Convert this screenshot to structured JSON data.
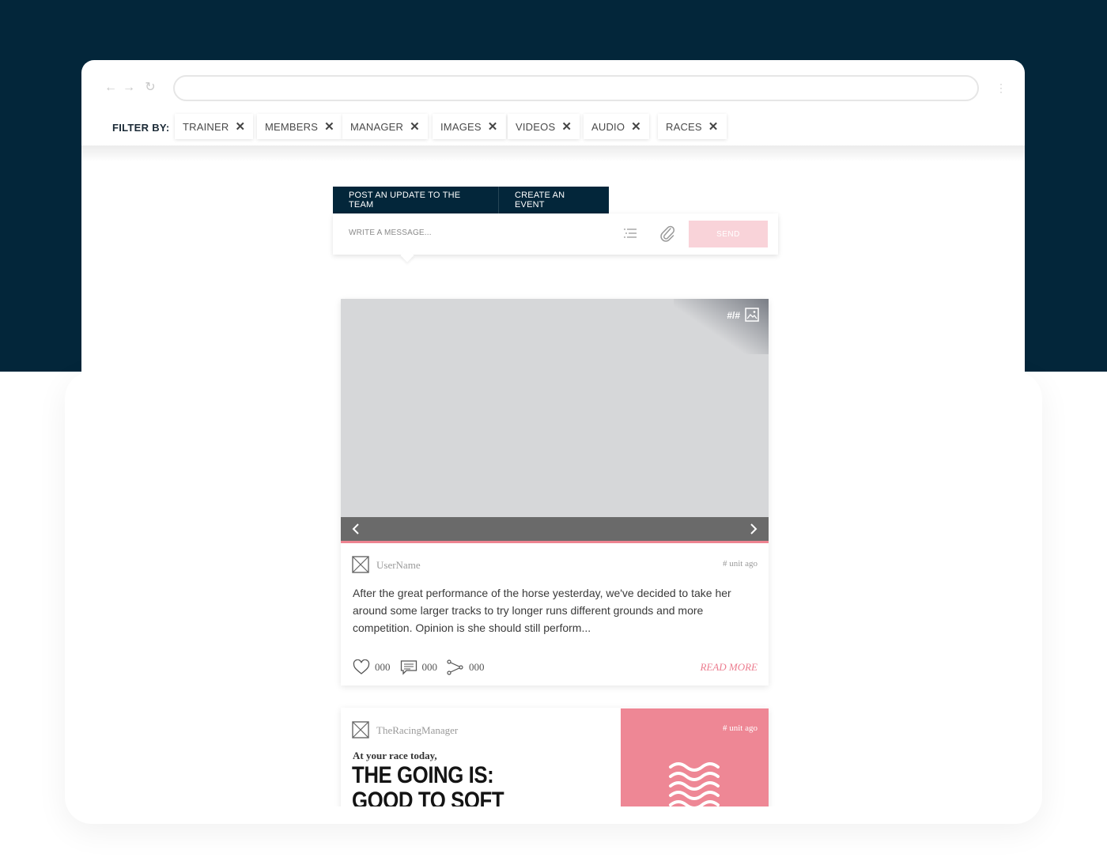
{
  "filter": {
    "label": "FILTER BY:",
    "chips": [
      "TRAINER",
      "MEMBERS",
      "MANAGER",
      "IMAGES",
      "VIDEOS",
      "AUDIO",
      "RACES"
    ],
    "remove_glyph": "✕"
  },
  "composer": {
    "tabs": [
      "POST AN UPDATE TO THE TEAM",
      "CREATE AN EVENT"
    ],
    "placeholder": "WRITE A MESSAGE...",
    "send_label": "SEND"
  },
  "post": {
    "media_count": "#/#",
    "username": "UserName",
    "time": "# unit ago",
    "body": "After the great performance of the horse yesterday, we've decided to take her around some larger tracks to try longer runs different grounds and more competition. Opinion is she should still perform...",
    "likes": "000",
    "comments": "000",
    "shares": "000",
    "read_more": "READ MORE"
  },
  "post2": {
    "username": "TheRacingManager",
    "time": "# unit ago",
    "intro": "At your race today,",
    "headline_line1": "THE GOING IS:",
    "headline_line2": "GOOD TO SOFT"
  },
  "colors": {
    "navy": "#03263a",
    "accent_pink": "#ee8391",
    "send_disabled": "#f9d3d9"
  }
}
